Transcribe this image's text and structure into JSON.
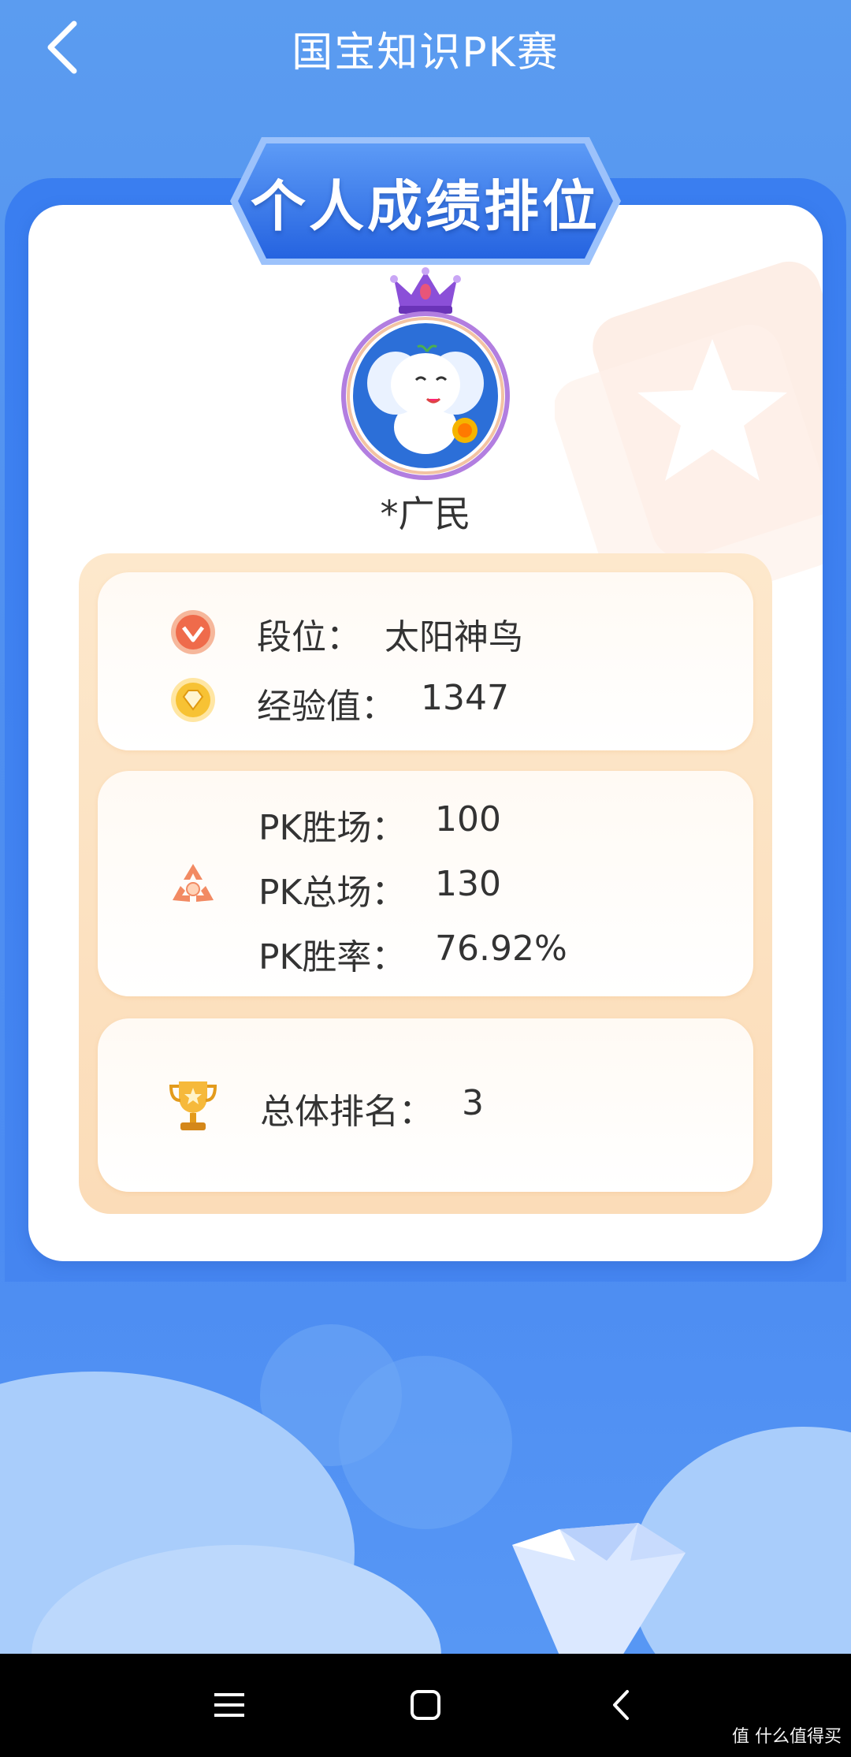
{
  "header": {
    "title": "国宝知识PK赛",
    "back_icon": "chevron-left-icon"
  },
  "banner": {
    "title": "个人成绩排位"
  },
  "user": {
    "name": "*广民",
    "avatar_icon": "elephant-mascot-avatar",
    "crown_icon": "crown-icon"
  },
  "rank_section": {
    "rank_label": "段位：",
    "rank_value": "太阳神鸟",
    "exp_label": "经验值：",
    "exp_value": "1347",
    "rank_icon": "rank-badge-icon",
    "exp_icon": "diamond-coin-icon"
  },
  "pk_section": {
    "icon": "pk-recycle-icon",
    "wins_label": "PK胜场：",
    "wins_value": "100",
    "total_label": "PK总场：",
    "total_value": "130",
    "rate_label": "PK胜率：",
    "rate_value": "76.92%"
  },
  "overall_section": {
    "icon": "trophy-icon",
    "label": "总体排名：",
    "value": "3"
  },
  "system_nav": {
    "menu_icon": "menu-icon",
    "home_icon": "home-square-icon",
    "back_icon": "back-chevron-icon"
  },
  "watermark": "值 什么值得买",
  "colors": {
    "primary_blue": "#4c8cf2",
    "banner_blue": "#2f6fe8",
    "orange_panel": "#fde3c2",
    "text": "#333333"
  }
}
